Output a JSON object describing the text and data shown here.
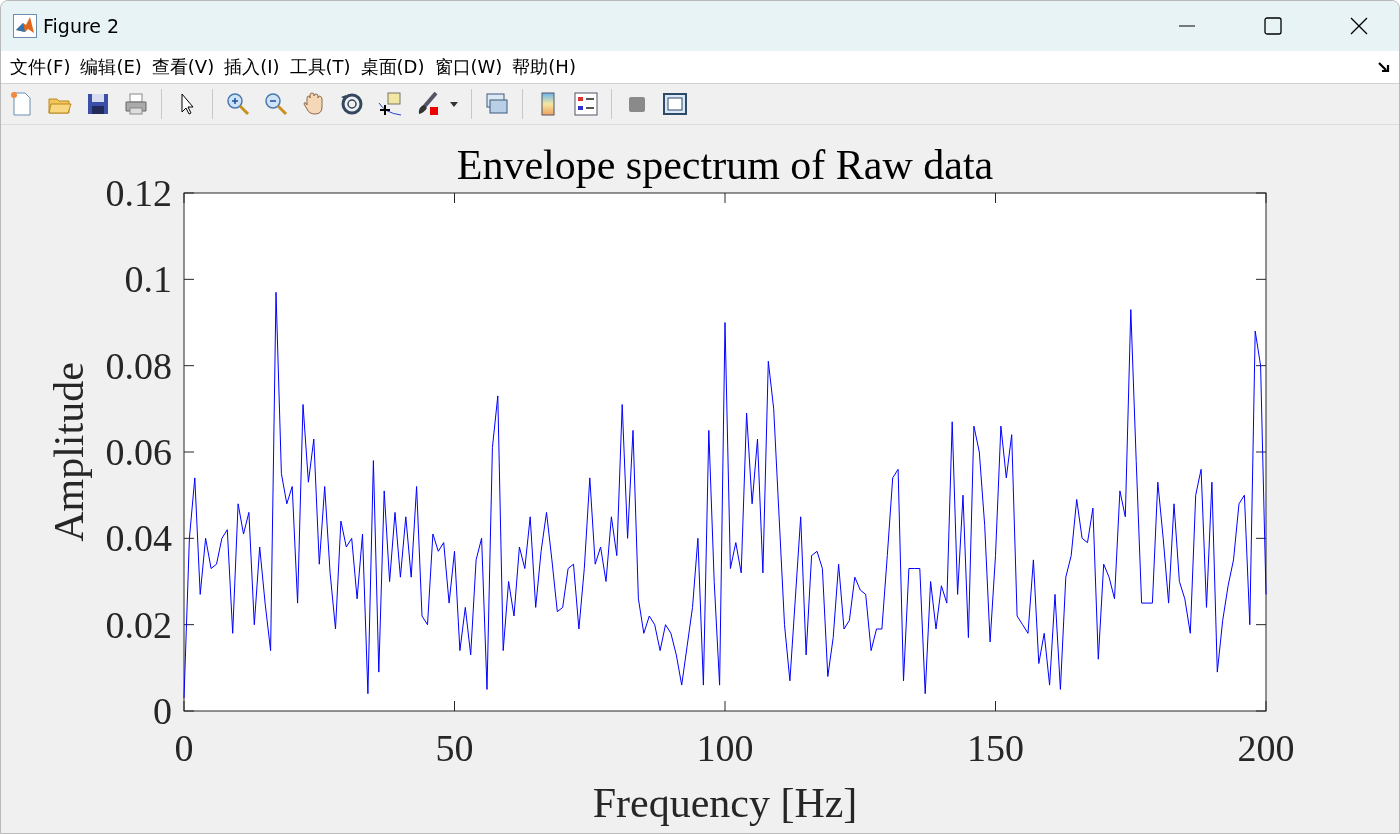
{
  "window": {
    "title": "Figure 2"
  },
  "menu": [
    "文件(F)",
    "编辑(E)",
    "查看(V)",
    "插入(I)",
    "工具(T)",
    "桌面(D)",
    "窗口(W)",
    "帮助(H)"
  ],
  "chart_data": {
    "type": "line",
    "title": "Envelope spectrum of Raw data",
    "xlabel": "Frequency [Hz]",
    "ylabel": "Amplitude",
    "xlim": [
      0,
      200
    ],
    "ylim": [
      0,
      0.12
    ],
    "xticks": [
      0,
      50,
      100,
      150,
      200
    ],
    "yticks": [
      0,
      {
        "value": 0.02,
        "label": "0.02"
      },
      {
        "value": 0.04,
        "label": "0.04"
      },
      {
        "value": 0.06,
        "label": "0.06"
      },
      {
        "value": 0.08,
        "label": "0.08"
      },
      {
        "value": 0.1,
        "label": "0.1"
      },
      {
        "value": 0.12,
        "label": "0.12"
      }
    ],
    "x": [
      0,
      1,
      2,
      3,
      4,
      5,
      6,
      7,
      8,
      9,
      10,
      11,
      12,
      13,
      14,
      15,
      16,
      17,
      18,
      19,
      20,
      21,
      22,
      23,
      24,
      25,
      26,
      27,
      28,
      29,
      30,
      31,
      32,
      33,
      34,
      35,
      36,
      37,
      38,
      39,
      40,
      41,
      42,
      43,
      44,
      45,
      46,
      47,
      48,
      49,
      50,
      51,
      52,
      53,
      54,
      55,
      56,
      57,
      58,
      59,
      60,
      61,
      62,
      63,
      64,
      65,
      66,
      67,
      68,
      69,
      70,
      71,
      72,
      73,
      74,
      75,
      76,
      77,
      78,
      79,
      80,
      81,
      82,
      83,
      84,
      85,
      86,
      87,
      88,
      89,
      90,
      91,
      92,
      93,
      94,
      95,
      96,
      97,
      98,
      99,
      100,
      101,
      102,
      103,
      104,
      105,
      106,
      107,
      108,
      109,
      110,
      111,
      112,
      113,
      114,
      115,
      116,
      117,
      118,
      119,
      120,
      121,
      122,
      123,
      124,
      125,
      126,
      127,
      128,
      129,
      130,
      131,
      132,
      133,
      134,
      135,
      136,
      137,
      138,
      139,
      140,
      141,
      142,
      143,
      144,
      145,
      146,
      147,
      148,
      149,
      150,
      151,
      152,
      153,
      154,
      155,
      156,
      157,
      158,
      159,
      160,
      161,
      162,
      163,
      164,
      165,
      166,
      167,
      168,
      169,
      170,
      171,
      172,
      173,
      174,
      175,
      176,
      177,
      178,
      179,
      180,
      181,
      182,
      183,
      184,
      185,
      186,
      187,
      188,
      189,
      190,
      191,
      192,
      193,
      194,
      195,
      196,
      197,
      198,
      199,
      200
    ],
    "series": [
      {
        "color": "#0000ff",
        "values": [
          0.003,
          0.04,
          0.054,
          0.027,
          0.04,
          0.033,
          0.034,
          0.04,
          0.042,
          0.018,
          0.048,
          0.041,
          0.046,
          0.02,
          0.038,
          0.025,
          0.014,
          0.097,
          0.055,
          0.048,
          0.052,
          0.025,
          0.071,
          0.053,
          0.063,
          0.034,
          0.052,
          0.032,
          0.019,
          0.044,
          0.038,
          0.04,
          0.026,
          0.041,
          0.004,
          0.058,
          0.009,
          0.051,
          0.03,
          0.046,
          0.031,
          0.045,
          0.031,
          0.052,
          0.022,
          0.02,
          0.041,
          0.037,
          0.039,
          0.025,
          0.037,
          0.014,
          0.024,
          0.013,
          0.035,
          0.04,
          0.005,
          0.061,
          0.073,
          0.014,
          0.03,
          0.022,
          0.038,
          0.033,
          0.045,
          0.024,
          0.037,
          0.046,
          0.035,
          0.023,
          0.024,
          0.033,
          0.034,
          0.019,
          0.033,
          0.054,
          0.034,
          0.038,
          0.03,
          0.045,
          0.036,
          0.071,
          0.04,
          0.065,
          0.026,
          0.018,
          0.022,
          0.02,
          0.014,
          0.02,
          0.018,
          0.013,
          0.006,
          0.015,
          0.024,
          0.04,
          0.006,
          0.065,
          0.03,
          0.006,
          0.09,
          0.033,
          0.039,
          0.032,
          0.069,
          0.048,
          0.063,
          0.032,
          0.081,
          0.07,
          0.045,
          0.02,
          0.007,
          0.026,
          0.045,
          0.013,
          0.036,
          0.037,
          0.033,
          0.008,
          0.017,
          0.034,
          0.019,
          0.021,
          0.031,
          0.028,
          0.027,
          0.014,
          0.019,
          0.019,
          0.036,
          0.054,
          0.056,
          0.007,
          0.033,
          0.033,
          0.033,
          0.004,
          0.03,
          0.019,
          0.029,
          0.025,
          0.067,
          0.027,
          0.05,
          0.017,
          0.066,
          0.06,
          0.043,
          0.016,
          0.036,
          0.066,
          0.054,
          0.064,
          0.022,
          0.02,
          0.018,
          0.035,
          0.011,
          0.018,
          0.006,
          0.027,
          0.005,
          0.031,
          0.036,
          0.049,
          0.04,
          0.039,
          0.047,
          0.012,
          0.034,
          0.031,
          0.026,
          0.051,
          0.045,
          0.093,
          0.058,
          0.025,
          0.025,
          0.025,
          0.053,
          0.04,
          0.025,
          0.048,
          0.03,
          0.026,
          0.018,
          0.05,
          0.056,
          0.024,
          0.053,
          0.009,
          0.021,
          0.029,
          0.035,
          0.048,
          0.05,
          0.02,
          0.088,
          0.08,
          0.027
        ]
      }
    ]
  }
}
